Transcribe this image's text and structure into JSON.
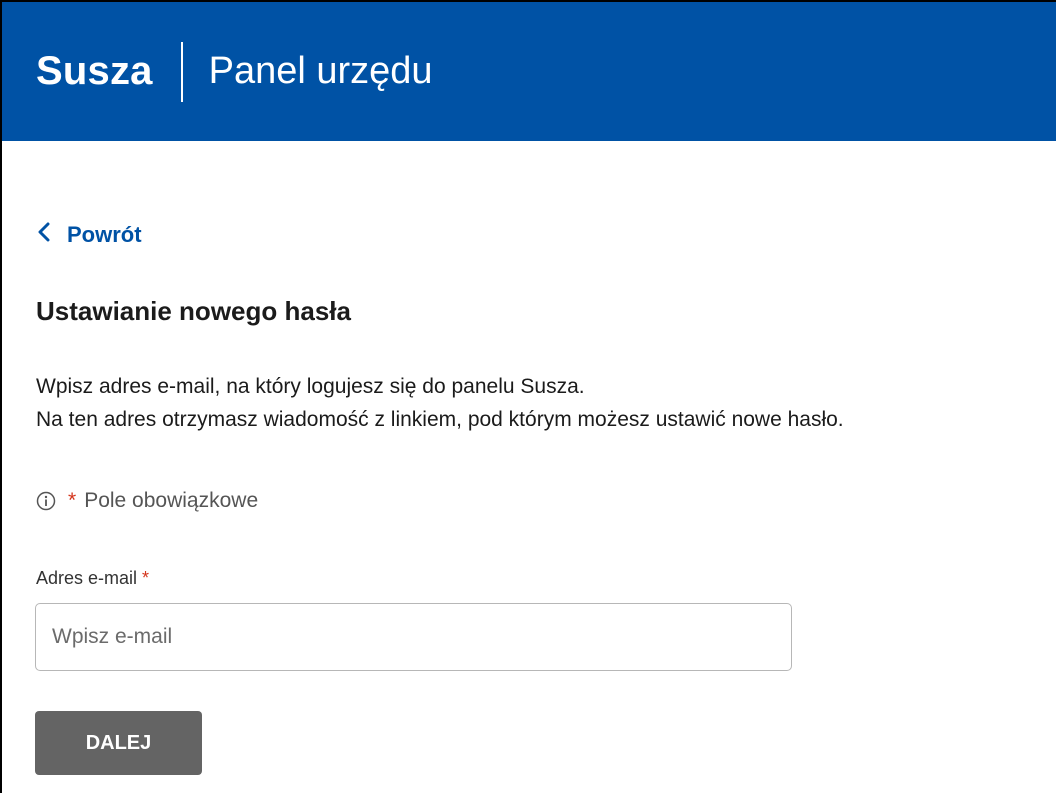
{
  "header": {
    "brand": "Susza",
    "subtitle": "Panel urzędu",
    "background_color": "#0052a5"
  },
  "nav": {
    "back_label": "Powrót",
    "back_icon": "chevron-left-icon"
  },
  "page": {
    "title": "Ustawianie nowego hasła",
    "description_lines": [
      "Wpisz adres e-mail, na który logujesz się do panelu Susza.",
      "Na ten adres otrzymasz wiadomość z linkiem, pod którym możesz ustawić nowe hasło."
    ]
  },
  "form": {
    "required_icon": "info-circle-icon",
    "required_asterisk": "*",
    "required_note": "Pole obowiązkowe",
    "email_label": "Adres e-mail",
    "email_asterisk": "*",
    "email_value": "",
    "email_placeholder": "Wpisz e-mail",
    "submit_label": "DALEJ"
  },
  "colors": {
    "accent": "#0052a5",
    "required": "#d4351c",
    "button": "#646464"
  }
}
